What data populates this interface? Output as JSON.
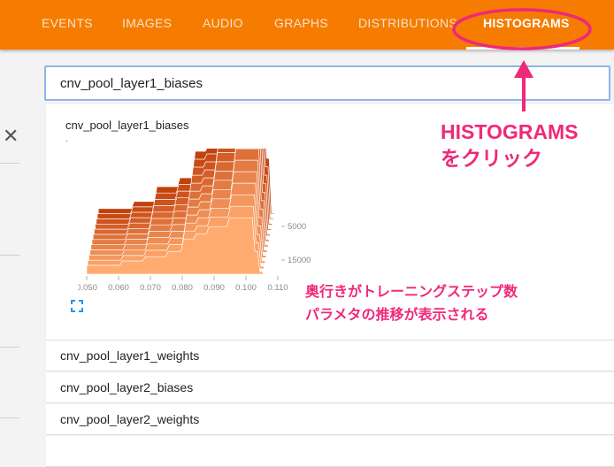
{
  "nav": {
    "tabs": [
      {
        "label": "EVENTS",
        "active": false
      },
      {
        "label": "IMAGES",
        "active": false
      },
      {
        "label": "AUDIO",
        "active": false
      },
      {
        "label": "GRAPHS",
        "active": false
      },
      {
        "label": "DISTRIBUTIONS",
        "active": false
      },
      {
        "label": "HISTOGRAMS",
        "active": true
      }
    ],
    "accent_color": "#f57c00"
  },
  "sidebar": {
    "close_icon": "close-icon"
  },
  "search": {
    "value": "cnv_pool_layer1_biases"
  },
  "histogram_card": {
    "title": "cnv_pool_layer1_biases",
    "subtitle": ".",
    "chart_data": {
      "type": "area",
      "x_ticks": [
        "0.050",
        "0.060",
        "0.070",
        "0.080",
        "0.090",
        "0.100",
        "0.110"
      ],
      "xlim": [
        0.05,
        0.11
      ],
      "step_ticks": [
        "5000",
        "15000"
      ],
      "color_front": "#ffab70",
      "color_back": "#c2410c"
    },
    "expand_icon": "fit-screen-icon"
  },
  "list": [
    {
      "label": "cnv_pool_layer1_weights"
    },
    {
      "label": "cnv_pool_layer2_biases"
    },
    {
      "label": "cnv_pool_layer2_weights"
    }
  ],
  "annotations": {
    "tab_hint_lines": [
      "HISTOGRAMS",
      "をクリック"
    ],
    "chart_hint_lines": [
      "奥行きがトレーニングステップ数",
      "パラメタの推移が表示される"
    ],
    "color": "#f0287a"
  }
}
